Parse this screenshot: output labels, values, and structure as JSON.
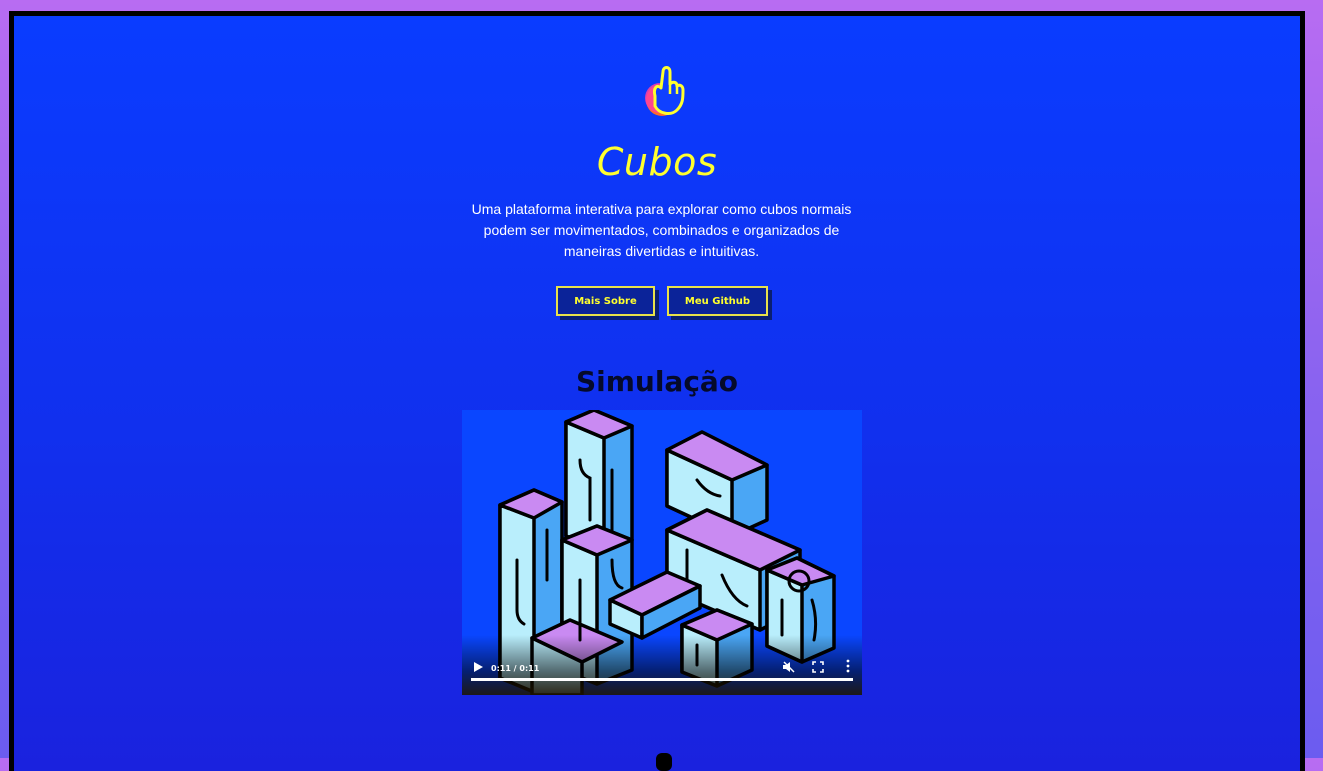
{
  "hero": {
    "icon": "pointing-hand-icon",
    "title": "Cubos",
    "description": "Uma plataforma interativa para explorar como cubos normais podem ser movimentados, combinados e organizados de maneiras divertidas e intuitivas.",
    "buttons": {
      "about": "Mais Sobre",
      "github": "Meu Github"
    }
  },
  "simulation": {
    "title": "Simulação",
    "video": {
      "time": "0:11 / 0:11",
      "progress": 1.0,
      "muted": true,
      "icons": [
        "play-icon",
        "muted-icon",
        "fullscreen-icon",
        "more-icon"
      ]
    }
  },
  "colors": {
    "accent": "#ffff2e",
    "background_top": "#0a3cff",
    "background_bottom": "#1a22de",
    "outer": "#b86cf2",
    "cube_purple": "#c98af2",
    "cube_light": "#b9eefc",
    "cube_blue": "#4aa6f5"
  }
}
